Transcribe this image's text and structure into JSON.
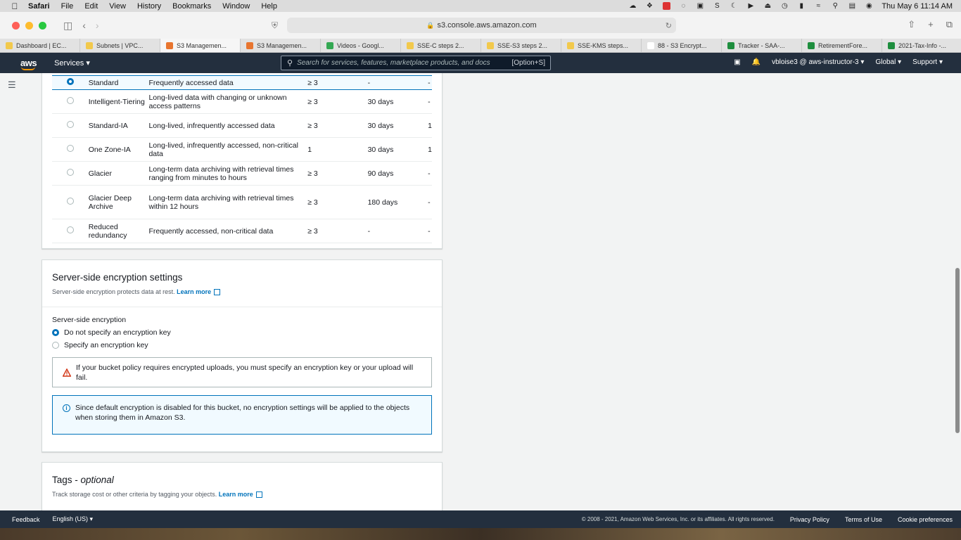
{
  "menubar": {
    "items": [
      "Safari",
      "File",
      "Edit",
      "View",
      "History",
      "Bookmarks",
      "Window",
      "Help"
    ],
    "datetime": "Thu May 6  11:14 AM"
  },
  "browser": {
    "url": "s3.console.aws.amazon.com",
    "tabs": [
      {
        "label": "Dashboard | EC...",
        "color": "#f2c94c"
      },
      {
        "label": "Subnets | VPC...",
        "color": "#f2c94c"
      },
      {
        "label": "S3 Managemen...",
        "color": "#e8752f"
      },
      {
        "label": "S3 Managemen...",
        "color": "#e8752f"
      },
      {
        "label": "Videos - Googl...",
        "color": "#34a853"
      },
      {
        "label": "SSE-C steps 2...",
        "color": "#f2c94c"
      },
      {
        "label": "SSE-S3 steps 2...",
        "color": "#f2c94c"
      },
      {
        "label": "SSE-KMS steps...",
        "color": "#f2c94c"
      },
      {
        "label": "88 - S3 Encrypt...",
        "color": "#ffffff"
      },
      {
        "label": "Tracker - SAA-...",
        "color": "#1e8e3e"
      },
      {
        "label": "RetirementFore...",
        "color": "#1e8e3e"
      },
      {
        "label": "2021-Tax-Info -...",
        "color": "#1e8e3e"
      }
    ],
    "active_tab": 2
  },
  "awsnav": {
    "logo": "aws",
    "services": "Services",
    "search_placeholder": "Search for services, features, marketplace products, and docs",
    "search_shortcut": "[Option+S]",
    "account": "vbloise3 @ aws-instructor-3",
    "region": "Global",
    "support": "Support"
  },
  "storage_classes": [
    {
      "name": "Standard",
      "use": "Frequently accessed data",
      "az": "≥ 3",
      "min_duration": "-",
      "last": "-",
      "selected": true
    },
    {
      "name": "Intelligent-Tiering",
      "use": "Long-lived data with changing or unknown access patterns",
      "az": "≥ 3",
      "min_duration": "30 days",
      "last": "-",
      "selected": false
    },
    {
      "name": "Standard-IA",
      "use": "Long-lived, infrequently accessed data",
      "az": "≥ 3",
      "min_duration": "30 days",
      "last": "1",
      "selected": false
    },
    {
      "name": "One Zone-IA",
      "use": "Long-lived, infrequently accessed, non-critical data",
      "az": "1",
      "min_duration": "30 days",
      "last": "1",
      "selected": false
    },
    {
      "name": "Glacier",
      "use": "Long-term data archiving with retrieval times ranging from minutes to hours",
      "az": "≥ 3",
      "min_duration": "90 days",
      "last": "-",
      "selected": false
    },
    {
      "name": "Glacier Deep Archive",
      "use": "Long-term data archiving with retrieval times within 12 hours",
      "az": "≥ 3",
      "min_duration": "180 days",
      "last": "-",
      "selected": false
    },
    {
      "name": "Reduced redundancy",
      "use": "Frequently accessed, non-critical data",
      "az": "≥ 3",
      "min_duration": "-",
      "last": "-",
      "selected": false
    }
  ],
  "encryption": {
    "title": "Server-side encryption settings",
    "description": "Server-side encryption protects data at rest.",
    "learn_more": "Learn more",
    "field_label": "Server-side encryption",
    "options": [
      {
        "label": "Do not specify an encryption key",
        "selected": true
      },
      {
        "label": "Specify an encryption key",
        "selected": false
      }
    ],
    "warning": "If your bucket policy requires encrypted uploads, you must specify an encryption key or your upload will fail.",
    "info": "Since default encryption is disabled for this bucket, no encryption settings will be applied to the objects when storing them in Amazon S3."
  },
  "tags": {
    "title": "Tags - ",
    "title_suffix": "optional",
    "description": "Track storage cost or other criteria by tagging your objects.",
    "learn_more": "Learn more"
  },
  "footer": {
    "feedback": "Feedback",
    "language": "English (US)",
    "copyright": "© 2008 - 2021, Amazon Web Services, Inc. or its affiliates. All rights reserved.",
    "privacy": "Privacy Policy",
    "terms": "Terms of Use",
    "cookies": "Cookie preferences"
  }
}
